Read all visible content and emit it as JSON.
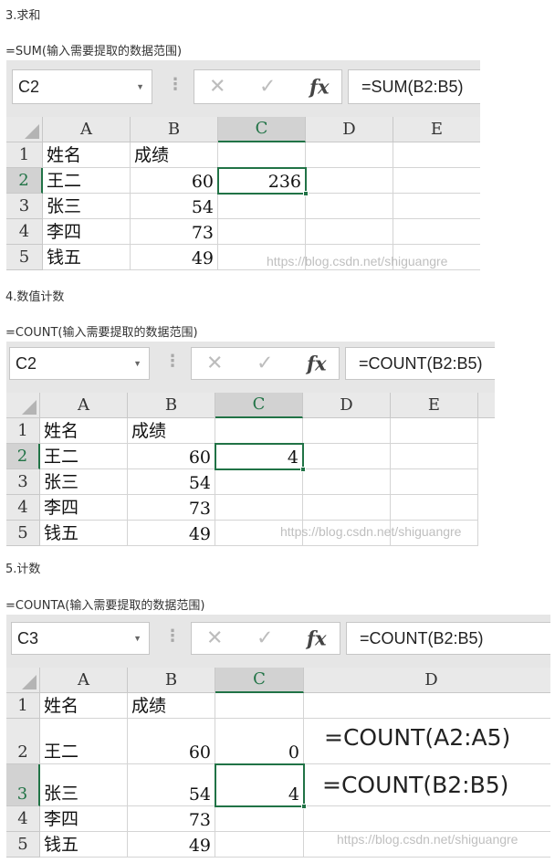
{
  "sections": [
    {
      "title": "3.求和",
      "syntax": "=SUM(输入需要提取的数据范围)",
      "name_box": "C2",
      "formula": "=SUM(B2:B5)",
      "columns": [
        "A",
        "B",
        "C",
        "D",
        "E"
      ],
      "rows": [
        {
          "num": "1",
          "name": "姓名",
          "score": "成绩",
          "c": ""
        },
        {
          "num": "2",
          "name": "王二",
          "score": "60",
          "c": "236"
        },
        {
          "num": "3",
          "name": "张三",
          "score": "54",
          "c": ""
        },
        {
          "num": "4",
          "name": "李四",
          "score": "73",
          "c": ""
        },
        {
          "num": "5",
          "name": "钱五",
          "score": "49",
          "c": ""
        }
      ],
      "watermark": "https://blog.csdn.net/shiguangre"
    },
    {
      "title": "4.数值计数",
      "syntax": "=COUNT(输入需要提取的数据范围)",
      "name_box": "C2",
      "formula": "=COUNT(B2:B5)",
      "columns": [
        "A",
        "B",
        "C",
        "D",
        "E"
      ],
      "rows": [
        {
          "num": "1",
          "name": "姓名",
          "score": "成绩",
          "c": ""
        },
        {
          "num": "2",
          "name": "王二",
          "score": "60",
          "c": "4"
        },
        {
          "num": "3",
          "name": "张三",
          "score": "54",
          "c": ""
        },
        {
          "num": "4",
          "name": "李四",
          "score": "73",
          "c": ""
        },
        {
          "num": "5",
          "name": "钱五",
          "score": "49",
          "c": ""
        }
      ],
      "watermark": "https://blog.csdn.net/shiguangre"
    },
    {
      "title": "5.计数",
      "syntax": "=COUNTA(输入需要提取的数据范围)",
      "name_box": "C3",
      "formula": "=COUNT(B2:B5)",
      "columns": [
        "A",
        "B",
        "C",
        "D"
      ],
      "rows": [
        {
          "num": "1",
          "name": "姓名",
          "score": "成绩",
          "c": ""
        },
        {
          "num": "2",
          "name": "王二",
          "score": "60",
          "c": "0"
        },
        {
          "num": "3",
          "name": "张三",
          "score": "54",
          "c": "4"
        },
        {
          "num": "4",
          "name": "李四",
          "score": "73",
          "c": ""
        },
        {
          "num": "5",
          "name": "钱五",
          "score": "49",
          "c": ""
        }
      ],
      "annotations": [
        "=COUNT(A2:A5)",
        "=COUNT(B2:B5)"
      ],
      "watermark": "https://blog.csdn.net/shiguangre"
    }
  ],
  "toolbar": {
    "cancel_icon": "✕",
    "enter_icon": "✓",
    "fx_label": "fx"
  },
  "colors": {
    "accent": "#217346",
    "header_bg": "#e9e9e9",
    "formula_bar_bg": "#e6e6e6"
  }
}
